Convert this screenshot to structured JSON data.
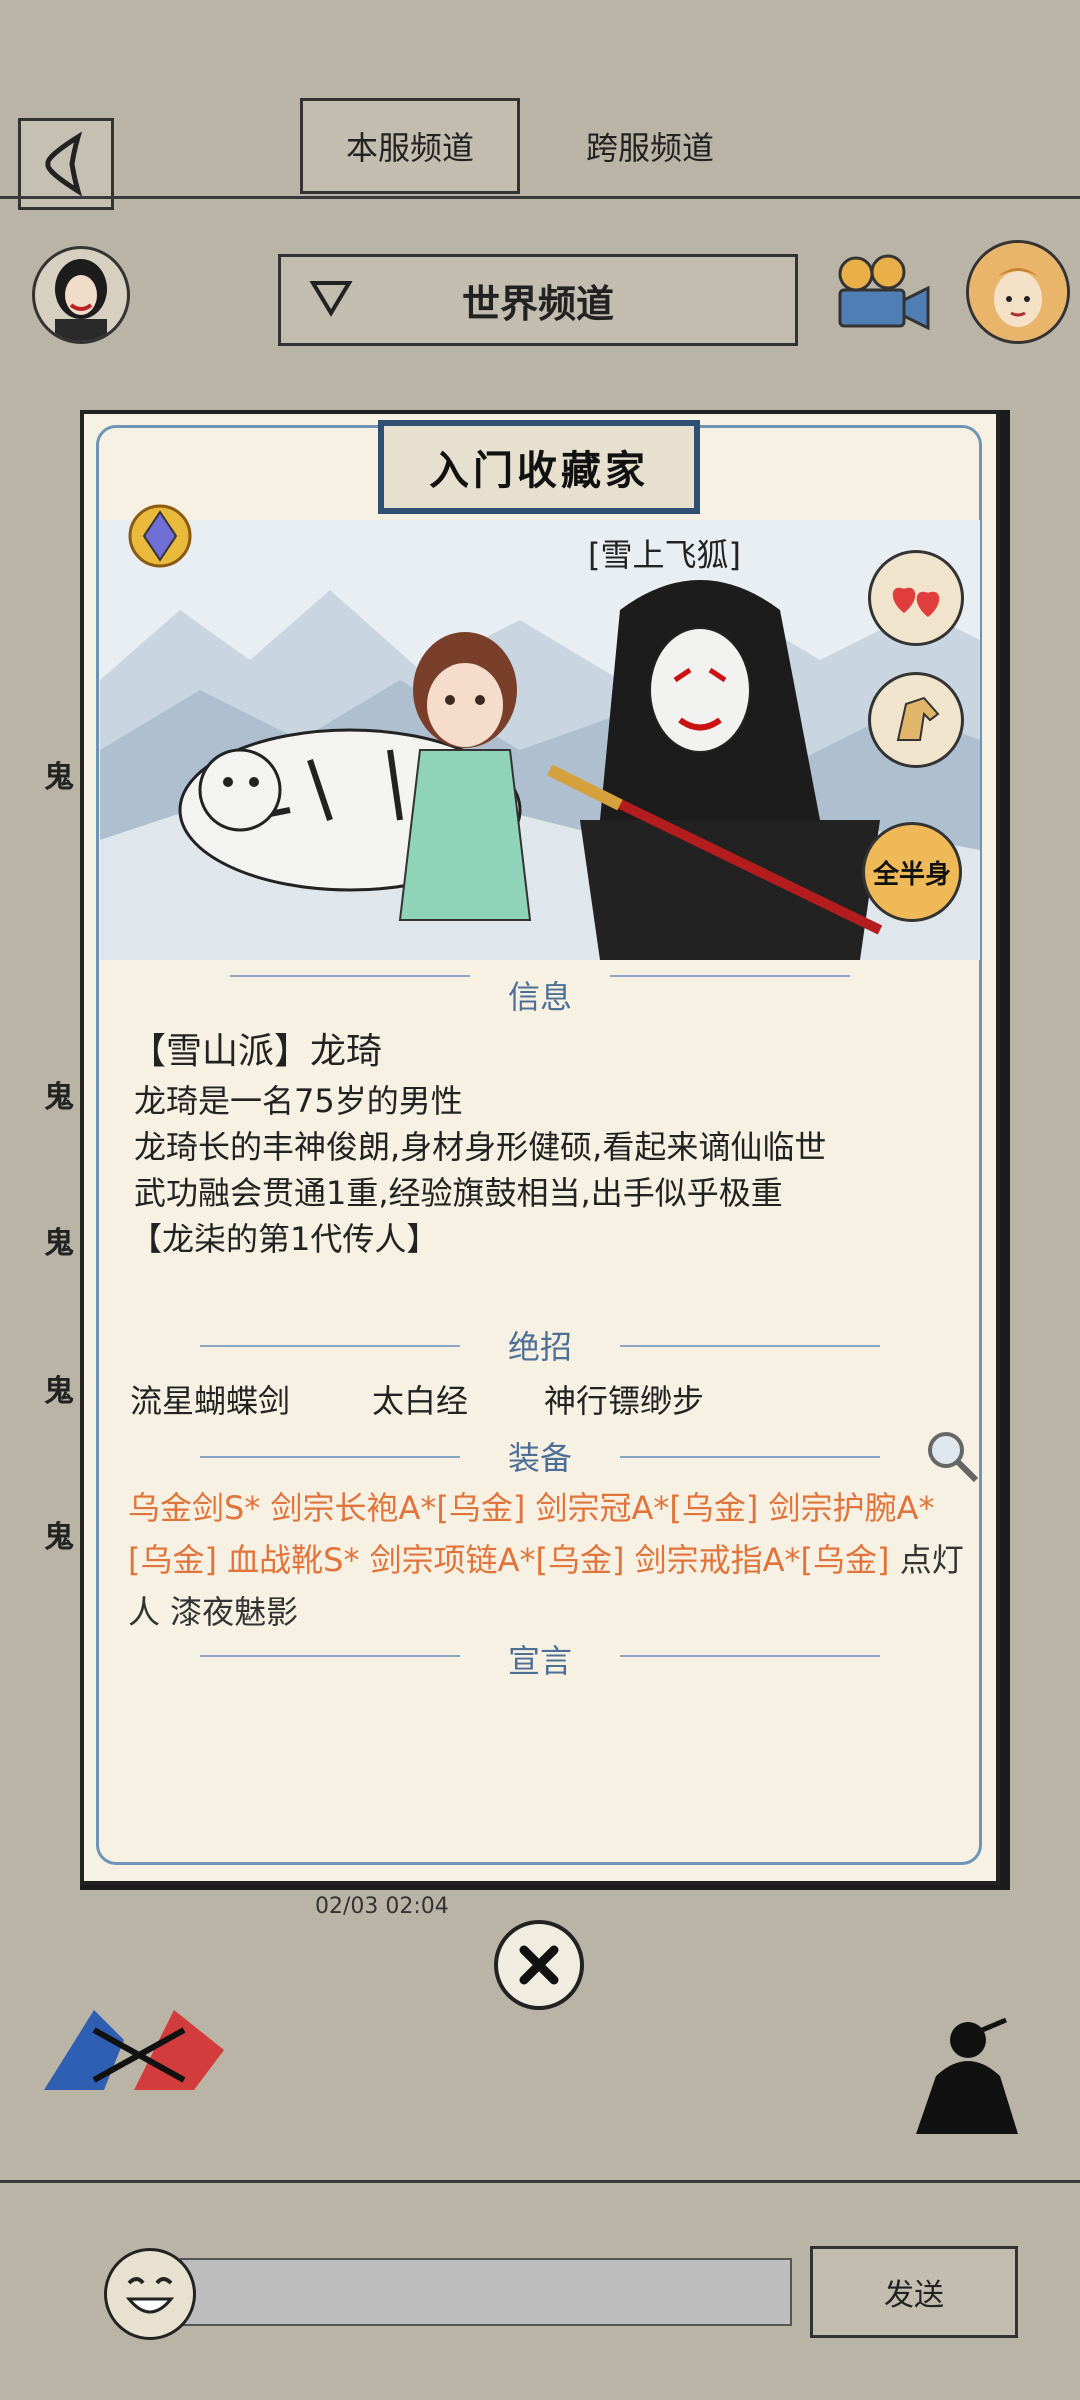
{
  "header": {
    "tabs": [
      {
        "label": "本服频道",
        "active": true
      },
      {
        "label": "跨服频道",
        "active": false
      }
    ]
  },
  "channel": {
    "selected": "世界频道"
  },
  "side_labels": [
    "鬼",
    "鬼",
    "鬼",
    "鬼",
    "鬼"
  ],
  "card": {
    "title": "入门收藏家",
    "character_name_tag": "[雪上飞狐]",
    "view_toggle_label": "全半身",
    "sections": {
      "info": "信息",
      "skills": "绝招",
      "equipment": "装备",
      "declaration": "宣言"
    },
    "info": {
      "title": "【雪山派】龙琦",
      "lines": [
        "龙琦是一名75岁的男性",
        "龙琦长的丰神俊朗,身材身形健硕,看起来谪仙临世",
        "武功融会贯通1重,经验旗鼓相当,出手似乎极重",
        "【龙柒的第1代传人】"
      ]
    },
    "skills": [
      "流星蝴蝶剑",
      "太白经",
      "神行镖缈步"
    ],
    "equipment_orange": "乌金剑S*  剑宗长袍A*[乌金]  剑宗冠A*[乌金]  剑宗护腕A*[乌金]  血战靴S*  剑宗项链A*[乌金]  剑宗戒指A*[乌金]",
    "equipment_gray": "点灯人  漆夜魅影"
  },
  "message": {
    "timestamp": "02/03 02:04"
  },
  "footer": {
    "send_label": "发送"
  },
  "colors": {
    "background": "#bab4a6",
    "card_bg": "#f6f1e3",
    "accent_blue": "#4d6f96",
    "equip_orange": "#e0743b"
  }
}
